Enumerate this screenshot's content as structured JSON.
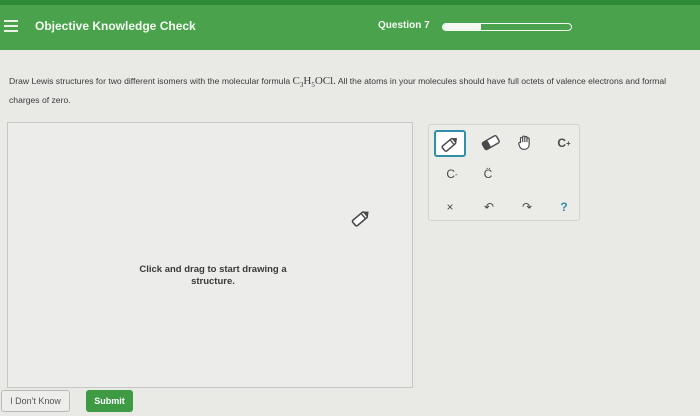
{
  "header": {
    "title": "Objective Knowledge Check",
    "question_label": "Question 7",
    "progress_fraction": 0.3
  },
  "prompt": {
    "text_before": "Draw Lewis structures for two different isomers with the molecular formula ",
    "formula_c": "C",
    "formula_c_sub": "3",
    "formula_h": "H",
    "formula_h_sub": "5",
    "formula_rest": "OCl.",
    "text_after": " All the atoms in your molecules should have full octets of valence electrons and formal charges of zero."
  },
  "canvas": {
    "hint_line1": "Click and drag to start drawing a",
    "hint_line2": "structure."
  },
  "toolbar": {
    "carbon_cation_label": "C",
    "carbon_cation_charge": "+",
    "carbon_anion_label": "C",
    "carbon_anion_charge": "-",
    "lone_pair_label": "C̈",
    "delete_label": "×",
    "undo_label": "↶",
    "redo_label": "↷",
    "help_label": "?"
  },
  "buttons": {
    "dont_know": "I Don't Know",
    "submit": "Submit"
  },
  "colors": {
    "header": "#4aa24d",
    "accent": "#2e8fa6",
    "submit": "#3e9a43"
  },
  "icons": [
    "menu-icon",
    "pencil-icon",
    "eraser-icon",
    "hand-icon"
  ]
}
